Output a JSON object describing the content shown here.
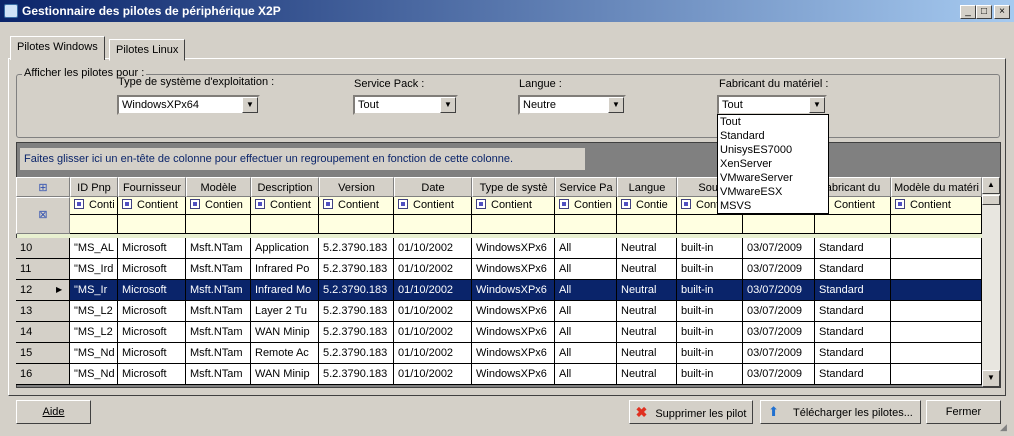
{
  "window": {
    "title": "Gestionnaire des pilotes de périphérique X2P"
  },
  "tabs": [
    "Pilotes Windows",
    "Pilotes Linux"
  ],
  "filters": {
    "group_label": "Afficher les pilotes pour :",
    "os": {
      "label": "Type de système d'exploitation :",
      "value": "WindowsXPx64"
    },
    "sp": {
      "label": "Service Pack :",
      "value": "Tout"
    },
    "lang": {
      "label": "Langue :",
      "value": "Neutre"
    },
    "maker": {
      "label": "Fabricant du matériel :",
      "value": "Tout",
      "options": [
        "Tout",
        "Standard",
        "UnisysES7000",
        "XenServer",
        "VMwareServer",
        "VMwareESX",
        "MSVS"
      ]
    }
  },
  "grid": {
    "group_hint": "Faites glisser ici un en-tête de colonne pour effectuer un regroupement en fonction de cette colonne.",
    "columns": [
      "ID Pnp",
      "Fournisseur",
      "Modèle",
      "Description",
      "Version",
      "Date",
      "Type de systè",
      "Service Pa",
      "Langue",
      "Sour",
      "",
      "abricant du",
      "Modèle du matéri"
    ],
    "filters": [
      "Conti",
      "Contient",
      "Contien",
      "Contient",
      "Contient",
      "Contient",
      "Contient",
      "Contien",
      "Contie",
      "Cont",
      "",
      "Contient",
      "Contient"
    ],
    "selected_row": "12",
    "rows": [
      [
        "10",
        "\"MS_AL",
        "Microsoft",
        "Msft.NTam",
        "Application",
        "5.2.3790.183",
        "01/10/2002",
        "WindowsXPx6",
        "All",
        "Neutral",
        "built-in",
        "03/07/2009",
        "Standard",
        ""
      ],
      [
        "11",
        "\"MS_Ird",
        "Microsoft",
        "Msft.NTam",
        "Infrared Po",
        "5.2.3790.183",
        "01/10/2002",
        "WindowsXPx6",
        "All",
        "Neutral",
        "built-in",
        "03/07/2009",
        "Standard",
        ""
      ],
      [
        "12",
        "\"MS_Ir",
        "Microsoft",
        "Msft.NTam",
        "Infrared Mo",
        "5.2.3790.183",
        "01/10/2002",
        "WindowsXPx6",
        "All",
        "Neutral",
        "built-in",
        "03/07/2009",
        "Standard",
        ""
      ],
      [
        "13",
        "\"MS_L2",
        "Microsoft",
        "Msft.NTam",
        "Layer 2 Tu",
        "5.2.3790.183",
        "01/10/2002",
        "WindowsXPx6",
        "All",
        "Neutral",
        "built-in",
        "03/07/2009",
        "Standard",
        ""
      ],
      [
        "14",
        "\"MS_L2",
        "Microsoft",
        "Msft.NTam",
        "WAN Minip",
        "5.2.3790.183",
        "01/10/2002",
        "WindowsXPx6",
        "All",
        "Neutral",
        "built-in",
        "03/07/2009",
        "Standard",
        ""
      ],
      [
        "15",
        "\"MS_Nd",
        "Microsoft",
        "Msft.NTam",
        "Remote Ac",
        "5.2.3790.183",
        "01/10/2002",
        "WindowsXPx6",
        "All",
        "Neutral",
        "built-in",
        "03/07/2009",
        "Standard",
        ""
      ],
      [
        "16",
        "\"MS_Nd",
        "Microsoft",
        "Msft.NTam",
        "WAN Minip",
        "5.2.3790.183",
        "01/10/2002",
        "WindowsXPx6",
        "All",
        "Neutral",
        "built-in",
        "03/07/2009",
        "Standard",
        ""
      ]
    ]
  },
  "buttons": {
    "help": "Aide",
    "delete": "Supprimer les pilot",
    "upload": "Télécharger les pilotes...",
    "close": "Fermer"
  }
}
